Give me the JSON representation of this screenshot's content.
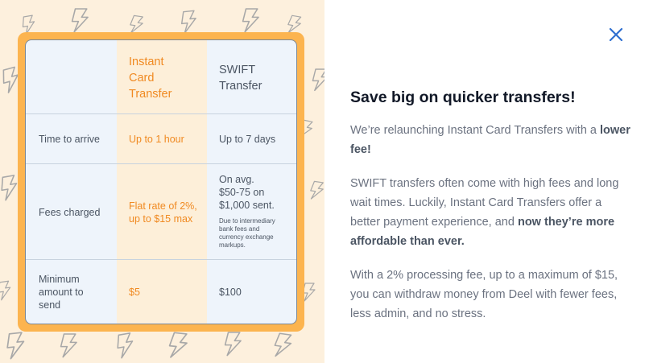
{
  "modal": {
    "close_icon": "close-icon",
    "title": "Save big on quicker transfers!",
    "p1_text": "We’re relaunching Instant Card Transfers with a ",
    "p1_bold": "lower fee!",
    "p2_text": "SWIFT transfers often come with high fees and long wait times. Luckily, Instant Card Transfers offer a better payment experience, and ",
    "p2_bold": "now they’re more affordable than ever.",
    "p3_text": "With a 2% processing fee, up to a maximum of $15, you can withdraw money from Deel with fewer fees, less admin, and no stress."
  },
  "comparison": {
    "col_instant": [
      "Instant",
      "Card",
      "Transfer"
    ],
    "col_swift": [
      "SWIFT",
      "Transfer"
    ],
    "rows": [
      {
        "label": [
          "Time to arrive"
        ],
        "instant": [
          "Up to 1 hour"
        ],
        "swift": [
          "Up to 7 days"
        ]
      },
      {
        "label": [
          "Fees charged"
        ],
        "instant": [
          "Flat rate of 2%,",
          "up to $15 max"
        ],
        "swift": [
          "On avg.",
          "$50-75 on",
          "$1,000 sent."
        ],
        "swift_note": [
          "Due to intermediary",
          "bank fees and",
          "currency exchange",
          "markups."
        ]
      },
      {
        "label": [
          "Minimum",
          "amount to",
          "send"
        ],
        "instant": [
          "$5"
        ],
        "swift": [
          "$100"
        ]
      }
    ]
  },
  "colors": {
    "accent_orange": "#f08a22",
    "frame_orange": "#fcb44f",
    "close_blue": "#2f6fd0"
  }
}
